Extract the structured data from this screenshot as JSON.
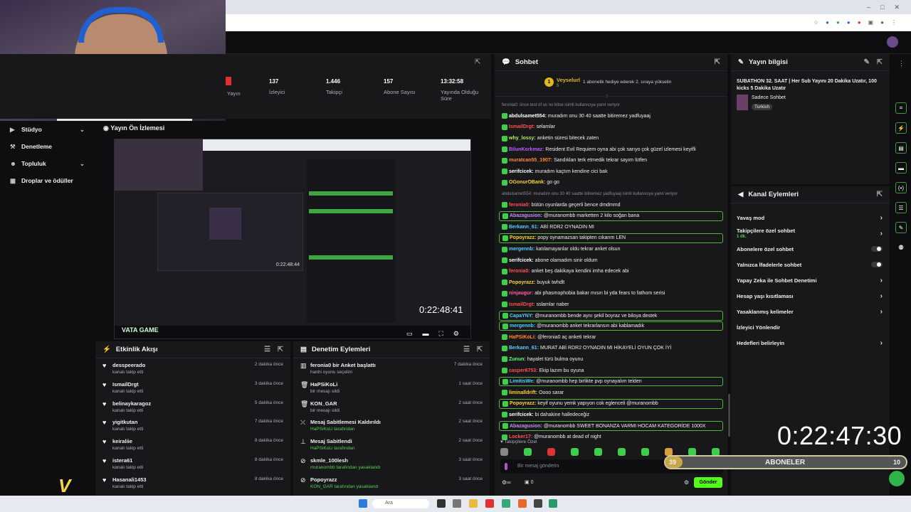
{
  "stats": [
    {
      "label": "Yayın",
      "value": ""
    },
    {
      "label": "İzleyici",
      "value": "137"
    },
    {
      "label": "Takipçi",
      "value": "1.446"
    },
    {
      "label": "Abone Sayısı",
      "value": "157"
    },
    {
      "label": "Yayında Olduğu Süre",
      "value": "13:32:58"
    }
  ],
  "sidebar": [
    {
      "label": "Stüdyo",
      "chevron": true
    },
    {
      "label": "Denetleme",
      "chevron": false
    },
    {
      "label": "Topluluk",
      "chevron": true
    },
    {
      "label": "Droplar ve ödüller",
      "chevron": false
    }
  ],
  "preview": {
    "title": "Yayın Ön İzlemesi",
    "inner_time": "0:22:48:44",
    "time": "0:22:48:41",
    "watermark": "VATA GAME"
  },
  "activity": {
    "title": "Etkinlik Akışı",
    "items": [
      {
        "name": "desspeerado",
        "sub": "kanalı takip etti",
        "time": "2 dakika önce"
      },
      {
        "name": "IsmailDrgt",
        "sub": "kanalı takip etti",
        "time": "3 dakika önce"
      },
      {
        "name": "belinaykaragoz",
        "sub": "kanalı takip etti",
        "time": "5 dakika önce"
      },
      {
        "name": "yigitkutan",
        "sub": "kanalı takip etti",
        "time": "7 dakika önce"
      },
      {
        "name": "keiraliie",
        "sub": "kanalı takip etti",
        "time": "8 dakika önce"
      },
      {
        "name": "istera61",
        "sub": "kanalı takip etti",
        "time": "8 dakika önce"
      },
      {
        "name": "Hasanali1453",
        "sub": "kanalı takip etti",
        "time": "8 dakika önce"
      }
    ]
  },
  "moderation": {
    "title": "Denetim Eylemleri",
    "items": [
      {
        "name": "feronia0 bir Anket başlattı",
        "sub": "hanhi oyunu seçelim",
        "time": "7 dakika önce",
        "green": false
      },
      {
        "name": "HaPSiKoLi",
        "sub": "bir mesajı sildi",
        "time": "1 saat önce",
        "green": false
      },
      {
        "name": "KON_GAR",
        "sub": "bir mesajı sildi",
        "time": "2 saat önce",
        "green": false
      },
      {
        "name": "Mesaj Sabitlemesi Kaldırıldı",
        "sub": "HaPSiKoLi tarafından",
        "time": "2 saat önce",
        "green": true
      },
      {
        "name": "Mesaj Sabitlendi",
        "sub": "HaPSiKoLi tarafından",
        "time": "2 saat önce",
        "green": true
      },
      {
        "name": "skmle_100lesh",
        "sub": "muranombb tarafından yasaklandı",
        "time": "3 saat önce",
        "green": true
      },
      {
        "name": "Popoyrazz",
        "sub": "KON_GAR tarafından yasaklandı",
        "time": "3 saat önce",
        "green": true
      }
    ]
  },
  "chat": {
    "title": "Sohbet",
    "pinned_user": "Veyselurl",
    "pinned_count": "5",
    "pinned_text": "1 abonelik hediye ederek 2. sıraya yükselin",
    "lines": [
      {
        "user": "",
        "text": "feronia0: önce test of us no bitse isimli kullanıcıya yanıt veriyor",
        "color": "#8a8a93",
        "hl": false,
        "sys": true
      },
      {
        "user": "abdulsamet554:",
        "text": "muradım onu 30 40 saatte bitiremez yadfuyaaj",
        "color": "#ffffff",
        "hl": false
      },
      {
        "user": "IsmailDrgt:",
        "text": "selamlar",
        "color": "#ff4f4f",
        "hl": false
      },
      {
        "user": "why_lossy:",
        "text": "anketin süresi bitecek zaten",
        "color": "#b8e86b",
        "hl": false
      },
      {
        "user": "BilunKorkmaz:",
        "text": "Resident Evil Requiem oyna abi çok sarıyo çok güzel izlemesi keyifli",
        "color": "#b85cff",
        "hl": false
      },
      {
        "user": "muratcan55_1907:",
        "text": "Sandıkları terk etmedik tekrar sayım lütfen",
        "color": "#ff8a2a",
        "hl": false
      },
      {
        "user": "serifcicek:",
        "text": "muradım kaçtım kendine cici bak",
        "color": "#ffffff",
        "hl": false
      },
      {
        "user": "OGonurOBank:",
        "text": "go go",
        "color": "#ffcf3a",
        "hl": false
      },
      {
        "user": "",
        "text": "abdulsamet554: muradım onu 30 40 saatte bitiremez yadfuyaaj isimli kullanıcıya yanıt veriyor",
        "color": "#8a8a93",
        "hl": false,
        "sys": true
      },
      {
        "user": "feronia0:",
        "text": "bütün oyunlarda geçerli bence dmdmmd",
        "color": "#ff4f4f",
        "hl": false
      },
      {
        "user": "Abazagusion:",
        "text": "@muranombb marketten 2 kilo soğan bana",
        "color": "#c58cff",
        "hl": true
      },
      {
        "user": "Berkann_61:",
        "text": "ABİ RDR2 OYNADIN MI",
        "color": "#52d0ff",
        "hl": false
      },
      {
        "user": "Popoyrazz:",
        "text": "popy oynamazsan takipten cıkarım LEN",
        "color": "#ffcf3a",
        "hl": true
      },
      {
        "user": "mergennb:",
        "text": "katılamayanlar oldu tekrar anket olsun",
        "color": "#52d0ff",
        "hl": false
      },
      {
        "user": "serifcicek:",
        "text": "abone olamadım sinir oldum",
        "color": "#ffffff",
        "hl": false
      },
      {
        "user": "feronia0:",
        "text": "anket beş dakikaya kendini imha edecek abi",
        "color": "#ff4f4f",
        "hl": false
      },
      {
        "user": "Popoyrazz:",
        "text": "buyuk twhdlt",
        "color": "#ffcf3a",
        "hl": false
      },
      {
        "user": "ninjaugur:",
        "text": "abi phasmophobia bakar mısın bi yda fears to fathom serisi",
        "color": "#ff5fa2",
        "hl": false
      },
      {
        "user": "IsmailDrgt:",
        "text": "sslamlar naber",
        "color": "#ff4f4f",
        "hl": false
      },
      {
        "user": "CapaYNY:",
        "text": "@muranombb bende aynı şekil boyraz ve biloya destek",
        "color": "#52d0ff",
        "hl": true
      },
      {
        "user": "mergennb:",
        "text": "@muranombb anket tekrarlansın abi kablamadık",
        "color": "#52d0ff",
        "hl": true
      },
      {
        "user": "HaPSiKoLi:",
        "text": "@feronia0 aç anketi tekrar",
        "color": "#ff8a2a",
        "hl": false
      },
      {
        "user": "Berkann_61:",
        "text": "MURAT ABİ RDR2 OYNADIN MI HİKAYELİ OYUN ÇOK İYİ",
        "color": "#52d0ff",
        "hl": false
      },
      {
        "user": "Zunun:",
        "text": "hayalet türü bulma oyunu",
        "color": "#52ff7a",
        "hl": false
      },
      {
        "user": "casper6753:",
        "text": "Ekip lazım bu oyuna",
        "color": "#ff4f4f",
        "hl": false
      },
      {
        "user": "LimitisWe:",
        "text": "@muranombb hep birlikte pvp oynayalım telden",
        "color": "#52d0ff",
        "hl": true
      },
      {
        "user": "liminalldrift:",
        "text": "Oooo sarar",
        "color": "#ffcf3a",
        "hl": false
      },
      {
        "user": "Popoyrazz:",
        "text": "keyif oyunu yemk yapıyon cok eglenceli @muranombb",
        "color": "#ffcf3a",
        "hl": true
      },
      {
        "user": "serifcicek:",
        "text": "bi dahakine halledeceğiz",
        "color": "#ffffff",
        "hl": false
      },
      {
        "user": "Abazagusion:",
        "text": "@muranombb SWEET BONANZA VARMI HOCAM KATEGORİDE 1000X",
        "color": "#c58cff",
        "hl": true
      },
      {
        "user": "Locker17:",
        "text": "@muranombb at dead of night",
        "color": "#ff4f4f",
        "hl": false
      }
    ],
    "followers_only": "Takipçilere Özel",
    "input_placeholder": "Bir mesaj gönderin",
    "send_label": "Gönder",
    "viewers_count": "0"
  },
  "stream_info": {
    "title": "Yayın bilgisi",
    "stream_title": "SUBATHON 32. SAAT | Her Sub Yayını 20 Dakika Uzatır, 100 kicks 5 Dakika Uzatır",
    "category": "Sadece Sohbet",
    "tag": "Turkish"
  },
  "channel_actions": {
    "title": "Kanal Eylemleri",
    "items": [
      {
        "label": "Yavaş mod",
        "kind": "chev",
        "sub": ""
      },
      {
        "label": "Takipçilere özel sohbet",
        "kind": "chev",
        "sub": "1 dk."
      },
      {
        "label": "Abonelere özel sohbet",
        "kind": "toggle",
        "sub": ""
      },
      {
        "label": "Yalnızca İfadelerle sohbet",
        "kind": "toggle",
        "sub": ""
      },
      {
        "label": "Yapay Zeka ile Sohbet Denetimi",
        "kind": "chev",
        "sub": ""
      },
      {
        "label": "Hesap yaşı kısıtlaması",
        "kind": "chev",
        "sub": ""
      },
      {
        "label": "Yasaklanmış kelimeler",
        "kind": "chev",
        "sub": ""
      },
      {
        "label": "İzleyici Yönlendir",
        "kind": "none",
        "sub": ""
      },
      {
        "label": "Hedefleri belirleyin",
        "kind": "chev",
        "sub": ""
      }
    ]
  },
  "overlay": {
    "timer": "0:22:47:30",
    "subs_label": "ABONELER",
    "subs_current": "39",
    "subs_goal": "10"
  },
  "taskbar": {
    "search_placeholder": "Ara"
  },
  "colors": {
    "accent": "#53fc18",
    "panel": "#18181b",
    "bg": "#0e0e10"
  }
}
